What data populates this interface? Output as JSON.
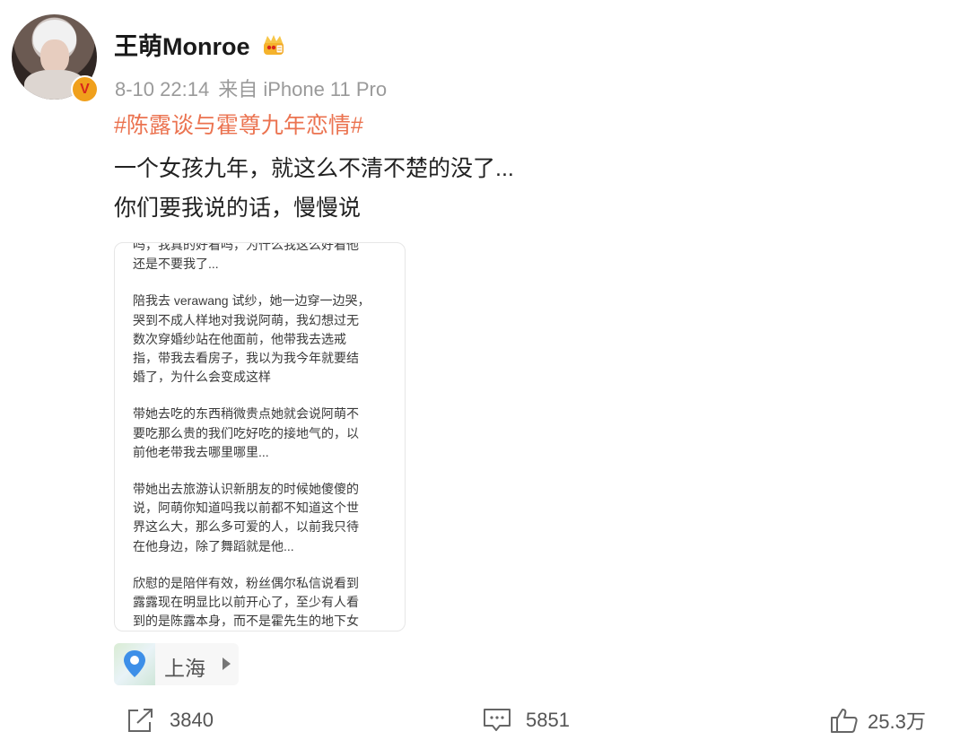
{
  "post": {
    "username": "王萌Monroe",
    "time": "8-10 22:14",
    "source": "来自 iPhone 11 Pro",
    "hashtag": "#陈露谈与霍尊九年恋情#",
    "text_lines": [
      "一个女孩九年，就这么不清不楚的没了...",
      "你们要我说的话，慢慢说"
    ],
    "location": "上海"
  },
  "image_card": {
    "paragraphs": [
      [
        "吗，我真的好看吗，为什么我这么好看他",
        "还是不要我了..."
      ],
      [
        "陪我去 verawang 试纱，她一边穿一边哭，",
        "哭到不成人样地对我说阿萌，我幻想过无",
        "数次穿婚纱站在他面前，他带我去选戒",
        "指，带我去看房子，我以为我今年就要结",
        "婚了，为什么会变成这样"
      ],
      [
        "带她去吃的东西稍微贵点她就会说阿萌不",
        "要吃那么贵的我们吃好吃的接地气的，以",
        "前他老带我去哪里哪里..."
      ],
      [
        "带她出去旅游认识新朋友的时候她傻傻的",
        "说，阿萌你知道吗我以前都不知道这个世",
        "界这么大，那么多可爱的人，以前我只待",
        "在他身边，除了舞蹈就是他..."
      ],
      [
        "欣慰的是陪伴有效，粉丝偶尔私信说看到",
        "露露现在明显比以前开心了，至少有人看",
        "到的是陈露本身，而不是霍先生的地下女"
      ]
    ]
  },
  "actions": {
    "repost_count": "3840",
    "comment_count": "5851",
    "like_count": "25.3万"
  },
  "colors": {
    "hashtag": "#eb7350",
    "meta_gray": "#9a9a9a",
    "badge_gold": "#f0a01c",
    "location_pin": "#3d8fe8"
  },
  "icons": [
    "verified-v-icon",
    "crown-icon",
    "location-pin-icon",
    "chevron-right-icon",
    "repost-icon",
    "comment-icon",
    "like-icon"
  ]
}
